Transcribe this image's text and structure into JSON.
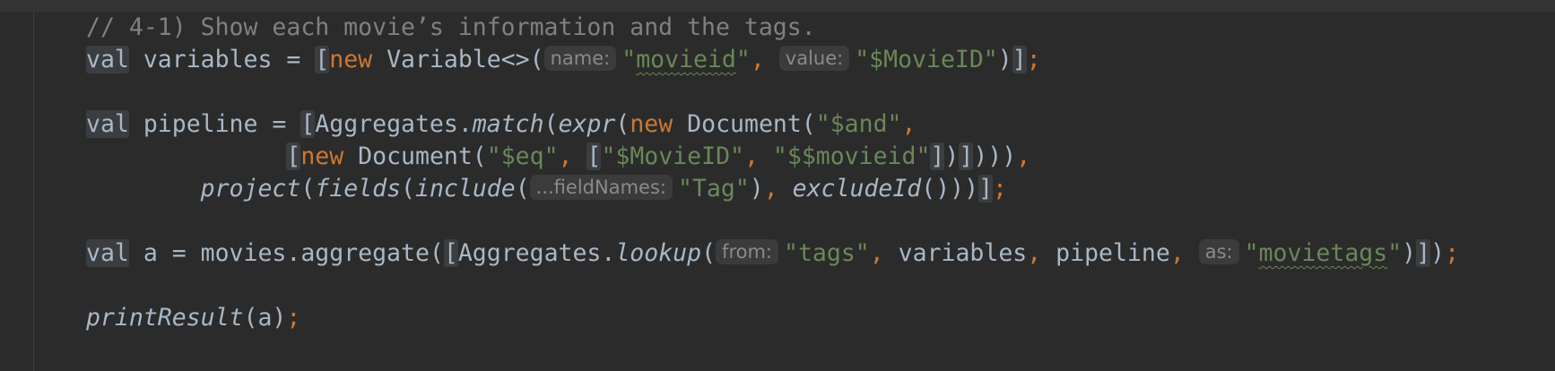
{
  "comment": "// 4-1) Show each movie’s information and the tags.",
  "l2": {
    "kw_val": "val",
    "name": " variables = ",
    "br_open": "[",
    "kw_new": "new",
    "cls": " Variable<>(",
    "hint_name": "name:",
    "s_movieid_q1": "\"",
    "s_movieid": "movieid",
    "s_movieid_q2": "\"",
    "comma": ", ",
    "hint_value": "value:",
    "s_movieidval": "\"$MovieID\"",
    "close_paren": ")",
    "br_close": "]",
    "semi": ";"
  },
  "l4": {
    "kw_val": "val",
    "name": " pipeline = ",
    "br_open": "[",
    "agg": "Aggregates.",
    "fn_match": "match",
    "p1": "(",
    "fn_expr": "expr",
    "p2": "(",
    "kw_new": "new",
    "doc": " Document(",
    "s_and": "\"$and\"",
    "comma": ","
  },
  "l5": {
    "indent": "              ",
    "br_open": "[",
    "kw_new": "new",
    "doc": " Document(",
    "s_eq": "\"$eq\"",
    "comma1": ", ",
    "br2_open": "[",
    "s_mid": "\"$MovieID\"",
    "comma2": ", ",
    "s_mvar": "\"$$movieid\"",
    "br2_close": "]",
    "close1": ")",
    "br_close": "]",
    "close2": ")))",
    "comma3": ","
  },
  "l6": {
    "indent": "        ",
    "fn_project": "project",
    "p1": "(",
    "fn_fields": "fields",
    "p2": "(",
    "fn_include": "include",
    "p3": "(",
    "hint_fieldnames": "...fieldNames:",
    "s_tag": "\"Tag\"",
    "close1": ")",
    "comma": ", ",
    "fn_excludeid": "excludeId",
    "close2": "()))",
    "br_close": "]",
    "semi": ";"
  },
  "l8": {
    "kw_val": "val",
    "name": " a = movies.aggregate(",
    "br_open": "[",
    "agg": "Aggregates.",
    "fn_lookup": "lookup",
    "p1": "(",
    "hint_from": "from:",
    "s_tags": "\"tags\"",
    "comma1": ", ",
    "var1": "variables",
    "comma2": ", ",
    "var2": "pipeline",
    "comma3": ", ",
    "hint_as": "as:",
    "s_mt_q1": "\"",
    "s_mt": "movietags",
    "s_mt_q2": "\"",
    "close1": ")",
    "br_close": "]",
    "close2": ")",
    "semi": ";"
  },
  "l10": {
    "fn_print": "printResult",
    "args": "(a)",
    "semi": ";"
  },
  "colors": {
    "background": "#2b2b2b",
    "text": "#a9b7c6",
    "keyword": "#cc7832",
    "string": "#6a8759",
    "comment": "#808080",
    "hint": "#8a8a8a"
  }
}
